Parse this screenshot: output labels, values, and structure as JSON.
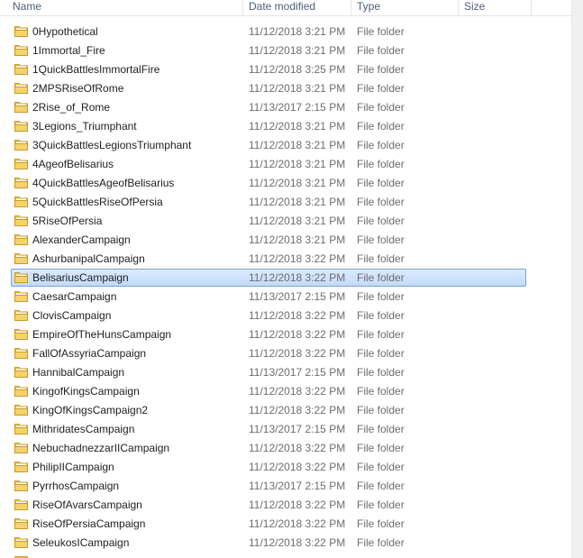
{
  "columns": {
    "name": "Name",
    "date_modified": "Date modified",
    "type": "Type",
    "size": "Size"
  },
  "colors": {
    "folder_body": "#e8c050",
    "folder_front": "#f5d36a",
    "selection_border": "#7da2ce",
    "selection_fill": "#cce4fc",
    "header_text": "#4c607a",
    "secondary_text": "#6d6d6d"
  },
  "icon": "folder-icon",
  "selected_index": 13,
  "rows": [
    {
      "name": "0Hypothetical",
      "date": "11/12/2018 3:21 PM",
      "type": "File folder",
      "size": ""
    },
    {
      "name": "1Immortal_Fire",
      "date": "11/12/2018 3:21 PM",
      "type": "File folder",
      "size": ""
    },
    {
      "name": "1QuickBattlesImmortalFire",
      "date": "11/12/2018 3:25 PM",
      "type": "File folder",
      "size": ""
    },
    {
      "name": "2MPSRiseOfRome",
      "date": "11/12/2018 3:21 PM",
      "type": "File folder",
      "size": ""
    },
    {
      "name": "2Rise_of_Rome",
      "date": "11/13/2017 2:15 PM",
      "type": "File folder",
      "size": ""
    },
    {
      "name": "3Legions_Triumphant",
      "date": "11/12/2018 3:21 PM",
      "type": "File folder",
      "size": ""
    },
    {
      "name": "3QuickBattlesLegionsTriumphant",
      "date": "11/12/2018 3:21 PM",
      "type": "File folder",
      "size": ""
    },
    {
      "name": "4AgeofBelisarius",
      "date": "11/12/2018 3:21 PM",
      "type": "File folder",
      "size": ""
    },
    {
      "name": "4QuickBattlesAgeofBelisarius",
      "date": "11/12/2018 3:21 PM",
      "type": "File folder",
      "size": ""
    },
    {
      "name": "5QuickBattlesRiseOfPersia",
      "date": "11/12/2018 3:21 PM",
      "type": "File folder",
      "size": ""
    },
    {
      "name": "5RiseOfPersia",
      "date": "11/12/2018 3:21 PM",
      "type": "File folder",
      "size": ""
    },
    {
      "name": "AlexanderCampaign",
      "date": "11/12/2018 3:21 PM",
      "type": "File folder",
      "size": ""
    },
    {
      "name": "AshurbanipalCampaign",
      "date": "11/12/2018 3:22 PM",
      "type": "File folder",
      "size": ""
    },
    {
      "name": "BelisariusCampaign",
      "date": "11/12/2018 3:22 PM",
      "type": "File folder",
      "size": ""
    },
    {
      "name": "CaesarCampaign",
      "date": "11/13/2017 2:15 PM",
      "type": "File folder",
      "size": ""
    },
    {
      "name": "ClovisCampaign",
      "date": "11/12/2018 3:22 PM",
      "type": "File folder",
      "size": ""
    },
    {
      "name": "EmpireOfTheHunsCampaign",
      "date": "11/12/2018 3:22 PM",
      "type": "File folder",
      "size": ""
    },
    {
      "name": "FallOfAssyriaCampaign",
      "date": "11/12/2018 3:22 PM",
      "type": "File folder",
      "size": ""
    },
    {
      "name": "HannibalCampaign",
      "date": "11/13/2017 2:15 PM",
      "type": "File folder",
      "size": ""
    },
    {
      "name": "KingofKingsCampaign",
      "date": "11/12/2018 3:22 PM",
      "type": "File folder",
      "size": ""
    },
    {
      "name": "KingOfKingsCampaign2",
      "date": "11/12/2018 3:22 PM",
      "type": "File folder",
      "size": ""
    },
    {
      "name": "MithridatesCampaign",
      "date": "11/13/2017 2:15 PM",
      "type": "File folder",
      "size": ""
    },
    {
      "name": "NebuchadnezzarIICampaign",
      "date": "11/12/2018 3:22 PM",
      "type": "File folder",
      "size": ""
    },
    {
      "name": "PhilipIICampaign",
      "date": "11/12/2018 3:22 PM",
      "type": "File folder",
      "size": ""
    },
    {
      "name": "PyrrhosCampaign",
      "date": "11/13/2017 2:15 PM",
      "type": "File folder",
      "size": ""
    },
    {
      "name": "RiseOfAvarsCampaign",
      "date": "11/12/2018 3:22 PM",
      "type": "File folder",
      "size": ""
    },
    {
      "name": "RiseOfPersiaCampaign",
      "date": "11/12/2018 3:22 PM",
      "type": "File folder",
      "size": ""
    },
    {
      "name": "SeleukosICampaign",
      "date": "11/12/2018 3:22 PM",
      "type": "File folder",
      "size": ""
    }
  ]
}
